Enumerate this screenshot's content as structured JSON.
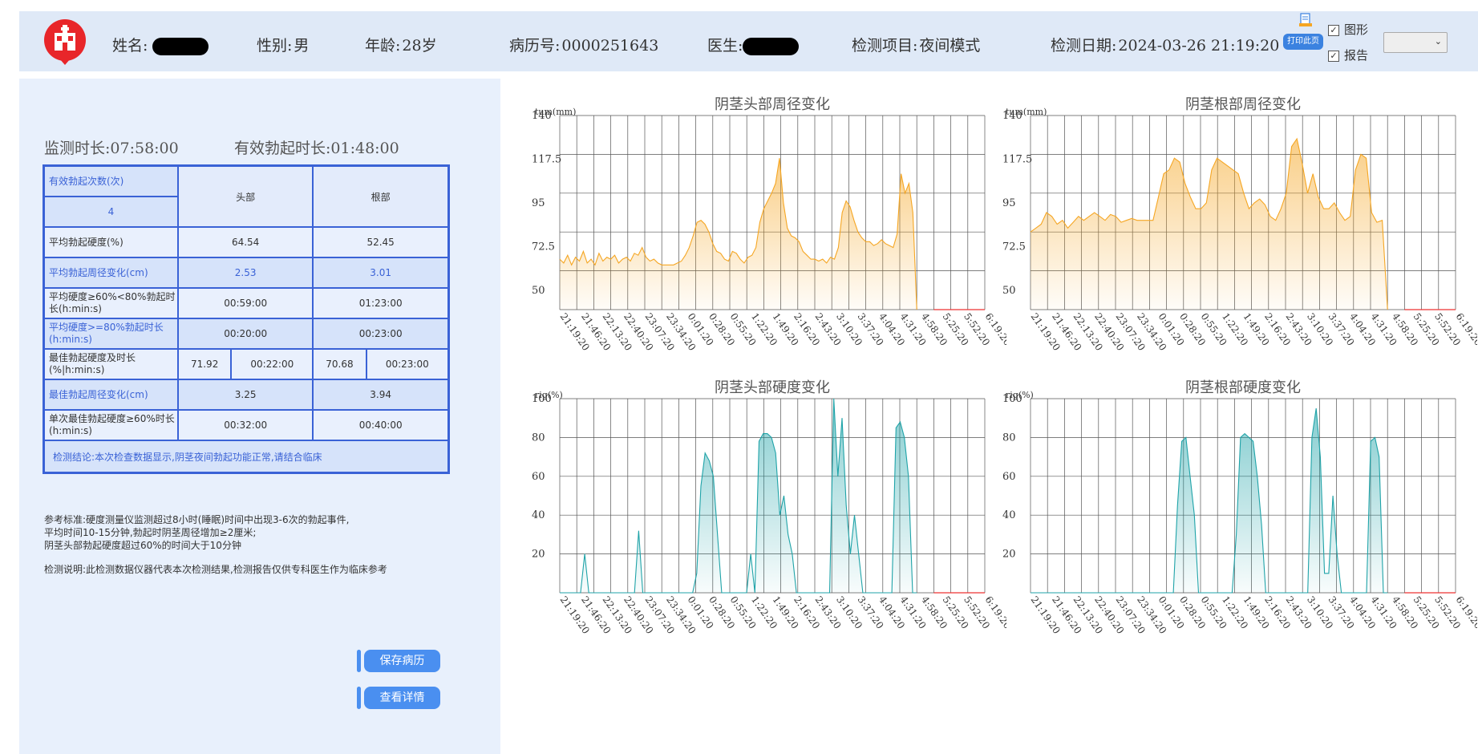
{
  "header": {
    "name_label": "姓名:",
    "gender_label": "性别:",
    "gender": "男",
    "age_label": "年龄:",
    "age": "28岁",
    "record_label": "病历号:",
    "record_no": "0000251643",
    "doctor_label": "医生:",
    "item_label": "检测项目:",
    "item": "夜间模式",
    "date_label": "检测日期:",
    "date": "2024-03-26 21:19:20",
    "print_label": "打印此页",
    "chk_graph": "图形",
    "chk_report": "报告"
  },
  "summary": {
    "duration": "监测时长:07:58:00",
    "effective": "有效勃起时长:01:48:00"
  },
  "table": {
    "count_label": "有效勃起次数(次)",
    "count": "4",
    "col_head": "头部",
    "col_root": "根部",
    "rows": [
      {
        "label": "平均勃起硬度(%)",
        "head": "64.54",
        "root": "52.45"
      },
      {
        "label": "平均勃起周径变化(cm)",
        "head": "2.53",
        "root": "3.01"
      },
      {
        "label": "平均硬度≥60%<80%勃起时长(h:min:s)",
        "head": "00:59:00",
        "root": "01:23:00"
      },
      {
        "label": "平均硬度>=80%勃起时长(h:min:s)",
        "head": "00:20:00",
        "root": "00:23:00"
      }
    ],
    "best": {
      "label": "最佳勃起硬度及时长(%|h:min:s)",
      "head_pct": "71.92",
      "head_time": "00:22:00",
      "root_pct": "70.68",
      "root_time": "00:23:00"
    },
    "best_circ": {
      "label": "最佳勃起周径变化(cm)",
      "head": "3.25",
      "root": "3.94"
    },
    "single": {
      "label": "单次最佳勃起硬度≥60%时长(h:min:s)",
      "head": "00:32:00",
      "root": "00:40:00"
    },
    "conclusion": "检测结论:本次检查数据显示,阴茎夜间勃起功能正常,请结合临床"
  },
  "reference": {
    "line1": "参考标准:硬度测量仪监测超过8小时(睡眠)时间中出现3-6次的勃起事件,",
    "line2": "平均时间10-15分钟,勃起时阴茎周径增加≥2厘米;",
    "line3": "阴茎头部勃起硬度超过60%的时间大于10分钟",
    "note": "检测说明:此检测数据仪器代表本次检测结果,检测报告仅供专科医生作为临床参考"
  },
  "buttons": {
    "save": "保存病历",
    "detail": "查看详情"
  },
  "colors": {
    "orange": "#f5a623",
    "teal": "#1fa3a8",
    "blue": "#3a62d6",
    "accent": "#3b82e0"
  },
  "chart_data": [
    {
      "type": "area",
      "title": "阴茎头部周径变化",
      "ylabel": "tum(mm)",
      "ylim": [
        40,
        140
      ],
      "yticks": [
        "50",
        "72.5",
        "95",
        "117.5",
        "140"
      ],
      "x": [
        "21:19:20",
        "21:46:20",
        "22:13:20",
        "22:40:20",
        "23:07:20",
        "23:34:20",
        "0:01:20",
        "0:28:20",
        "0:55:20",
        "1:22:20",
        "1:49:20",
        "2:16:20",
        "2:43:20",
        "3:10:20",
        "3:37:20",
        "4:04:20",
        "4:31:20",
        "4:58:20",
        "5:25:20",
        "5:52:20",
        "6:19:20"
      ],
      "values": [
        66,
        64,
        68,
        63,
        67,
        65,
        70,
        64,
        66,
        63,
        69,
        65,
        67,
        66,
        68,
        64,
        66,
        67,
        65,
        69,
        68,
        72,
        67,
        65,
        66,
        64,
        63,
        63,
        63,
        63,
        64,
        65,
        68,
        72,
        78,
        85,
        86,
        84,
        80,
        74,
        70,
        69,
        66,
        65,
        70,
        69,
        66,
        64,
        67,
        68,
        72,
        85,
        92,
        96,
        100,
        105,
        118,
        95,
        82,
        78,
        77,
        75,
        70,
        68,
        66,
        66,
        65,
        66,
        64,
        67,
        66,
        72,
        90,
        96,
        93,
        86,
        80,
        77,
        75,
        75,
        73,
        74,
        76,
        74,
        73,
        72,
        79,
        110,
        100,
        105,
        90,
        0
      ],
      "grid": true
    },
    {
      "type": "area",
      "title": "阴茎根部周径变化",
      "ylabel": "tum(mm)",
      "ylim": [
        40,
        140
      ],
      "yticks": [
        "50",
        "72.5",
        "95",
        "117.5",
        "140"
      ],
      "x": [
        "21:19:20",
        "21:46:20",
        "22:13:20",
        "22:40:20",
        "23:07:20",
        "23:34:20",
        "0:01:20",
        "0:28:20",
        "0:55:20",
        "1:22:20",
        "1:49:20",
        "2:16:20",
        "2:43:20",
        "3:10:20",
        "3:37:20",
        "4:04:20",
        "4:31:20",
        "4:58:20",
        "5:25:20",
        "5:52:20",
        "6:19:20"
      ],
      "values": [
        80,
        82,
        84,
        90,
        88,
        84,
        86,
        82,
        85,
        88,
        86,
        88,
        90,
        88,
        86,
        89,
        88,
        85,
        86,
        87,
        86,
        86,
        86,
        86,
        98,
        110,
        112,
        118,
        116,
        105,
        98,
        92,
        92,
        95,
        112,
        118,
        116,
        114,
        112,
        110,
        100,
        92,
        95,
        97,
        94,
        88,
        86,
        92,
        100,
        124,
        128,
        115,
        100,
        110,
        98,
        92,
        92,
        95,
        90,
        86,
        88,
        112,
        120,
        118,
        90,
        85,
        86,
        0
      ],
      "grid": true
    },
    {
      "type": "area",
      "title": "阴茎头部硬度变化",
      "ylabel": "rig(%)",
      "ylim": [
        0,
        100
      ],
      "yticks": [
        "20",
        "40",
        "60",
        "80",
        "100"
      ],
      "x": [
        "21:19:20",
        "21:46:20",
        "22:13:20",
        "22:40:20",
        "23:07:20",
        "23:34:20",
        "0:01:20",
        "0:28:20",
        "0:55:20",
        "1:22:20",
        "1:49:20",
        "2:16:20",
        "2:43:20",
        "3:10:20",
        "3:37:20",
        "4:04:20",
        "4:31:20",
        "4:58:20",
        "5:25:20",
        "5:52:20",
        "6:19:20"
      ],
      "values": [
        0,
        0,
        0,
        0,
        0,
        0,
        20,
        0,
        0,
        0,
        0,
        0,
        0,
        0,
        0,
        0,
        0,
        0,
        0,
        32,
        0,
        0,
        0,
        0,
        0,
        0,
        0,
        0,
        0,
        0,
        0,
        0,
        0,
        10,
        55,
        72,
        68,
        60,
        30,
        0,
        0,
        0,
        0,
        0,
        0,
        0,
        20,
        0,
        78,
        82,
        82,
        80,
        72,
        40,
        50,
        30,
        20,
        0,
        0,
        0,
        0,
        0,
        0,
        0,
        0,
        0,
        100,
        60,
        90,
        45,
        20,
        40,
        20,
        0,
        0,
        0,
        0,
        0,
        0,
        0,
        0,
        85,
        88,
        80,
        60,
        0,
        0
      ],
      "grid": true
    },
    {
      "type": "area",
      "title": "阴茎根部硬度变化",
      "ylabel": "rig(%)",
      "ylim": [
        0,
        100
      ],
      "yticks": [
        "20",
        "40",
        "60",
        "80",
        "100"
      ],
      "x": [
        "21:19:20",
        "21:46:20",
        "22:13:20",
        "22:40:20",
        "23:07:20",
        "23:34:20",
        "0:01:20",
        "0:28:20",
        "0:55:20",
        "1:22:20",
        "1:49:20",
        "2:16:20",
        "2:43:20",
        "3:10:20",
        "3:37:20",
        "4:04:20",
        "4:31:20",
        "4:58:20",
        "5:25:20",
        "5:52:20",
        "6:19:20"
      ],
      "values": [
        0,
        0,
        0,
        0,
        0,
        0,
        0,
        0,
        0,
        0,
        0,
        0,
        0,
        0,
        0,
        0,
        0,
        0,
        0,
        0,
        0,
        0,
        0,
        0,
        0,
        0,
        0,
        0,
        0,
        0,
        0,
        0,
        0,
        0,
        0,
        45,
        78,
        80,
        60,
        40,
        0,
        0,
        0,
        0,
        0,
        0,
        0,
        0,
        0,
        30,
        80,
        82,
        80,
        78,
        60,
        35,
        0,
        0,
        0,
        0,
        0,
        0,
        0,
        0,
        0,
        0,
        0,
        80,
        95,
        70,
        10,
        10,
        50,
        20,
        0,
        0,
        0,
        0,
        0,
        0,
        0,
        78,
        80,
        70,
        0,
        0
      ],
      "grid": true
    }
  ]
}
